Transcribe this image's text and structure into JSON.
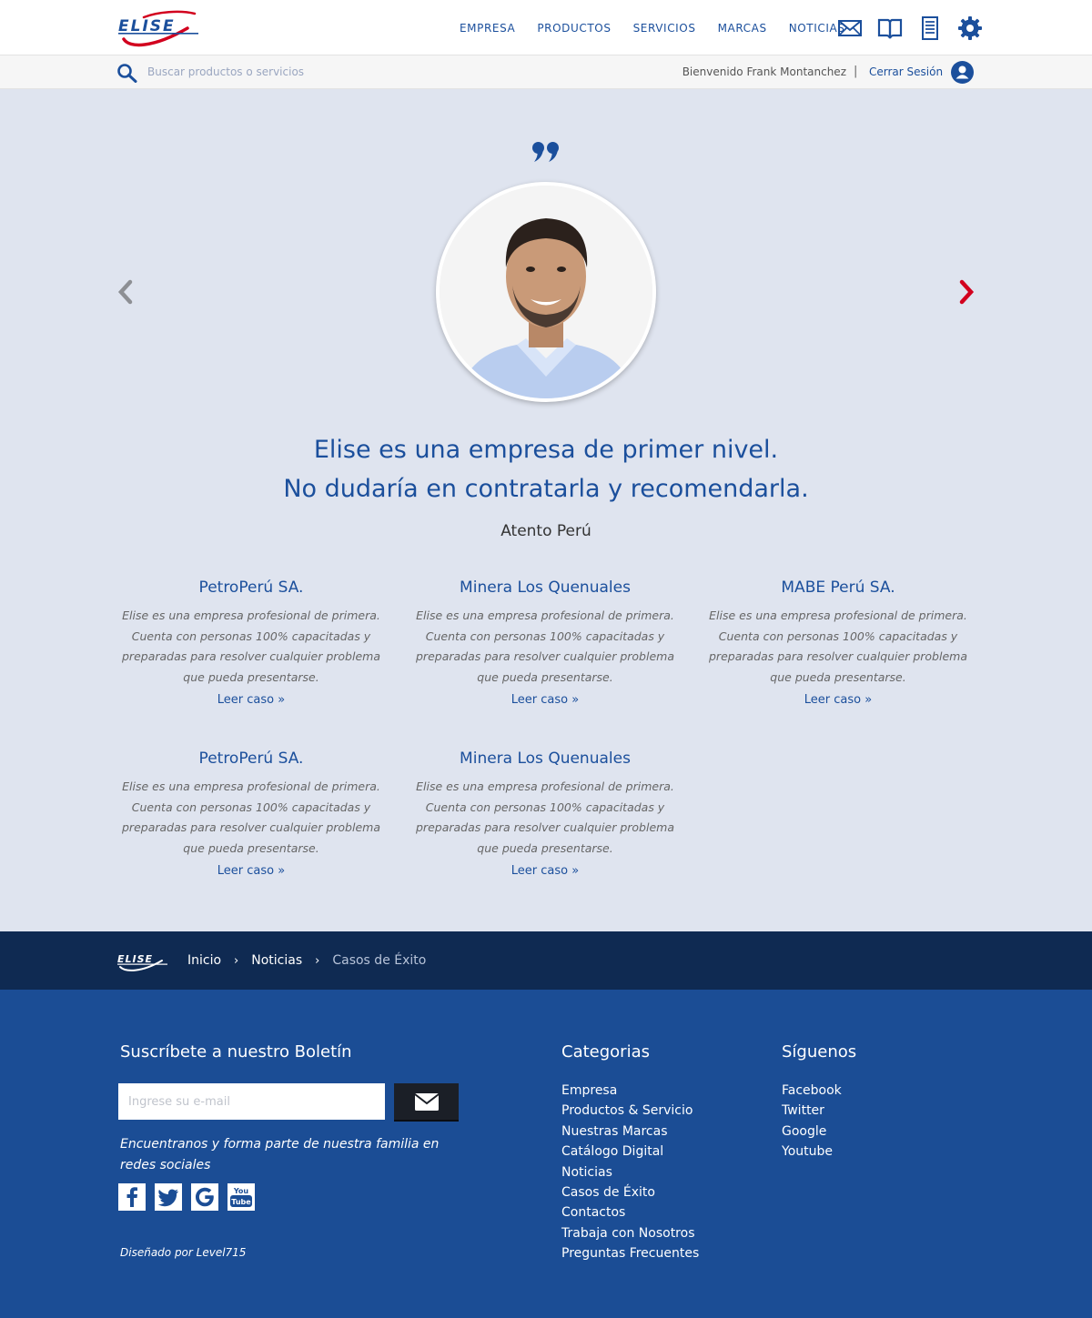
{
  "brand": {
    "name": "ELISE",
    "primary": "#1b4f9c",
    "accent": "#d2001e"
  },
  "nav": {
    "items": [
      "EMPRESA",
      "PRODUCTOS",
      "SERVICIOS",
      "MARCAS",
      "NOTICIAS"
    ],
    "icons": [
      "mail-icon",
      "catalog-book-icon",
      "list-document-icon",
      "settings-gear-icon"
    ]
  },
  "search": {
    "placeholder": "Buscar productos o servicios"
  },
  "user": {
    "welcome": "Bienvenido Frank Montanchez",
    "separator": "|",
    "logout": "Cerrar Sesión"
  },
  "testimonial": {
    "quote_lines": [
      "Elise es una empresa de primer nivel.",
      "No dudaría en contratarla y recomendarla."
    ],
    "author": "Atento Perú"
  },
  "cases": [
    {
      "title": "PetroPerú SA.",
      "text": "Elise es una empresa profesional de primera. Cuenta con personas 100% capacitadas y preparadas para resolver cualquier problema que pueda presentarse.",
      "link": "Leer caso »"
    },
    {
      "title": "Minera Los Quenuales",
      "text": "Elise es una empresa profesional de primera. Cuenta con personas 100% capacitadas y preparadas para resolver cualquier problema que pueda presentarse.",
      "link": "Leer caso »"
    },
    {
      "title": "MABE Perú SA.",
      "text": "Elise es una empresa profesional de primera. Cuenta con personas 100% capacitadas y preparadas para resolver cualquier problema que pueda presentarse.",
      "link": "Leer caso »"
    },
    {
      "title": "PetroPerú SA.",
      "text": "Elise es una empresa profesional de primera. Cuenta con personas 100% capacitadas y preparadas para resolver cualquier problema que pueda presentarse.",
      "link": "Leer caso »"
    },
    {
      "title": "Minera Los Quenuales",
      "text": "Elise es una empresa profesional de primera. Cuenta con personas 100% capacitadas y preparadas para resolver cualquier problema que pueda presentarse.",
      "link": "Leer caso »"
    }
  ],
  "breadcrumb": {
    "items": [
      "Inicio",
      "Noticias"
    ],
    "separator": "›",
    "current": "Casos de Éxito"
  },
  "footer": {
    "newsletter": {
      "title": "Suscríbete a nuestro Boletín",
      "placeholder": "Ingrese su e-mail",
      "note": "Encuentranos y forma parte de nuestra familia en redes sociales"
    },
    "social_icons": [
      "facebook-icon",
      "twitter-icon",
      "google-icon",
      "youtube-icon"
    ],
    "credit": "Diseñado por Level715",
    "categories": {
      "title": "Categorias",
      "items": [
        "Empresa",
        "Productos & Servicio",
        "Nuestras Marcas",
        "Catálogo Digital",
        "Noticias",
        "Casos de Éxito",
        "Contactos",
        "Trabaja con Nosotros",
        "Preguntas Frecuentes"
      ]
    },
    "follow": {
      "title": "Síguenos",
      "items": [
        "Facebook",
        "Twitter",
        "Google",
        "Youtube"
      ]
    }
  }
}
